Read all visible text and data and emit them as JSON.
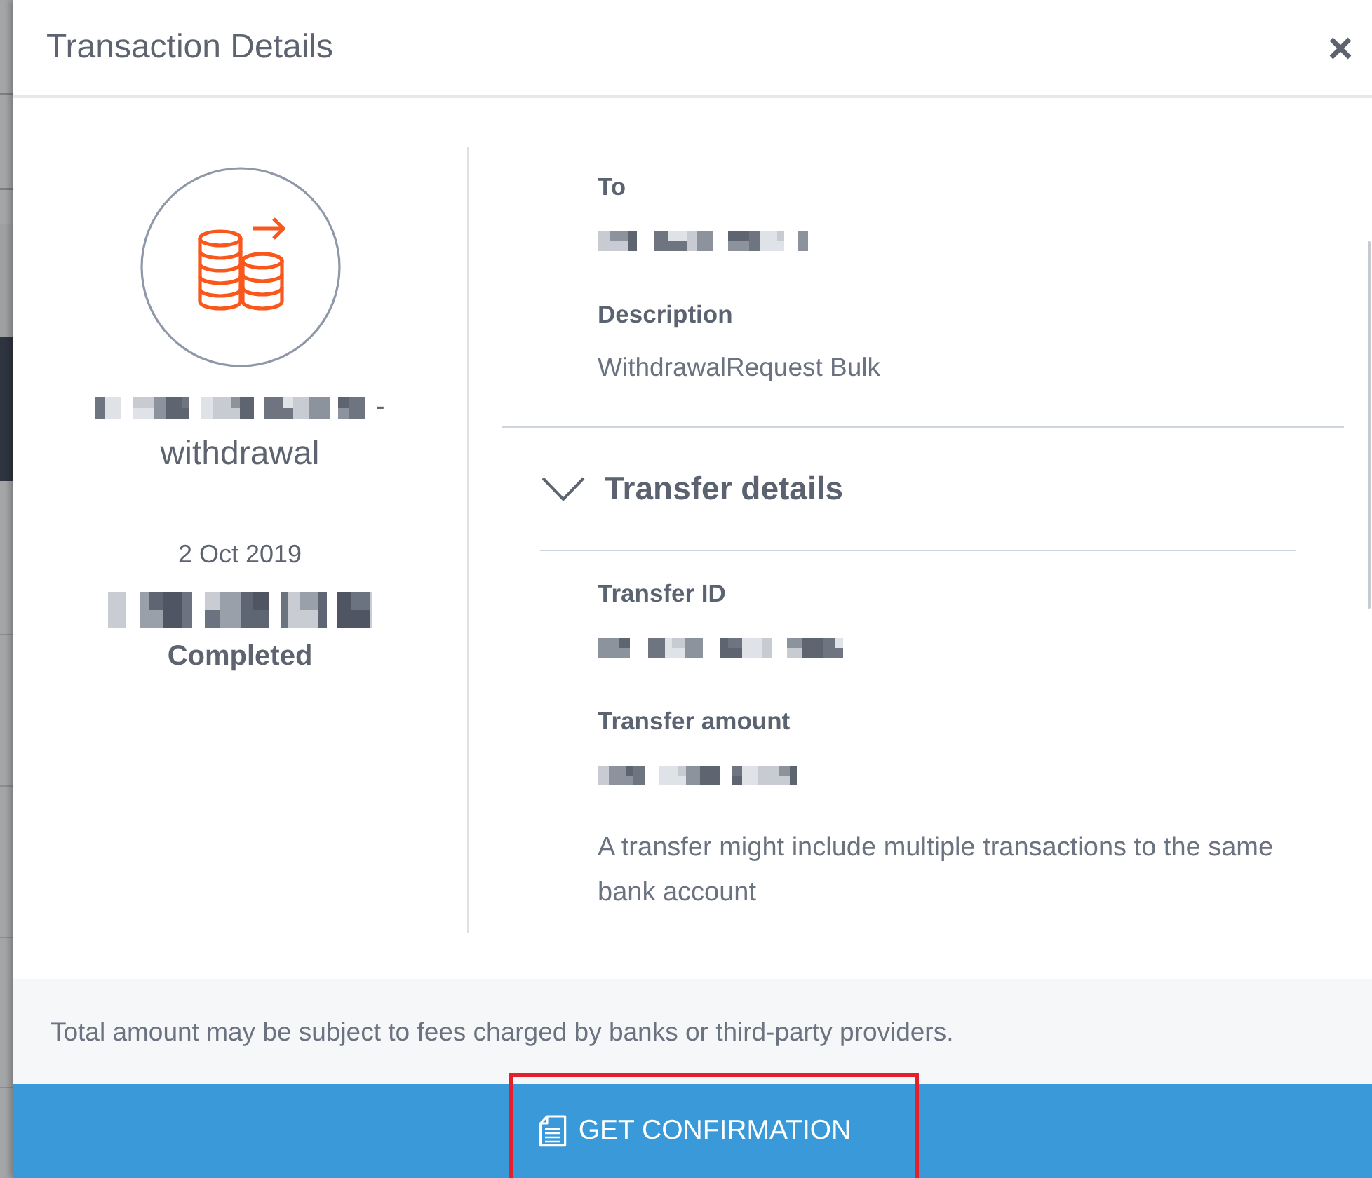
{
  "window": {
    "title": "Transaction Details"
  },
  "summary": {
    "name_redacted": true,
    "name_separator": "-",
    "transaction_type": "withdrawal",
    "date": "2 Oct 2019",
    "amount_redacted": true,
    "status": "Completed"
  },
  "details": [
    {
      "label": "To",
      "redacted": true
    },
    {
      "label": "Description",
      "value": "WithdrawalRequest Bulk"
    }
  ],
  "transfer_section": {
    "title": "Transfer details",
    "expanded": true,
    "fields": [
      {
        "label": "Transfer ID",
        "redacted": true
      },
      {
        "label": "Transfer amount",
        "redacted": true
      }
    ],
    "note": "A transfer might include multiple transactions to the same bank account"
  },
  "footer": {
    "disclaimer": "Total amount may be subject to fees charged by banks or third-party providers."
  },
  "primary_action": {
    "label": "GET CONFIRMATION",
    "highlighted": true
  }
}
